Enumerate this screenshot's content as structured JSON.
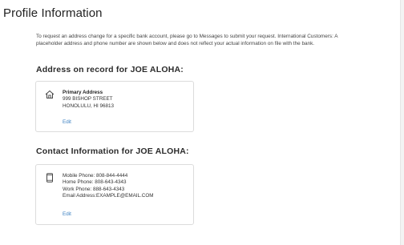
{
  "page": {
    "title": "Profile Information",
    "intro": "To request an address change for a specific bank account, please go to Messages to submit your request. International Customers: A placeholder address and phone number are shown below and does not reflect your actual information on file with the bank."
  },
  "address_section": {
    "heading": "Address on record for JOE ALOHA:",
    "icon": "home-icon",
    "label": "Primary Address",
    "street": "999 BISHOP STREET",
    "city_state_zip": "HONOLULU, HI 96813",
    "edit_label": "Edit"
  },
  "contact_section": {
    "heading": "Contact Information for JOE ALOHA:",
    "icon": "mobile-phone-icon",
    "mobile": "Mobile Phone: 808-844-4444",
    "home": "Home Phone: 808-643-4343",
    "work": "Work Phone: 888-643-4343",
    "email": "Email Address:EXAMPLE@EMAIL.COM",
    "edit_label": "Edit"
  },
  "colors": {
    "link": "#3a7fc1",
    "card_border": "#dcdcdc",
    "text": "#333333"
  }
}
